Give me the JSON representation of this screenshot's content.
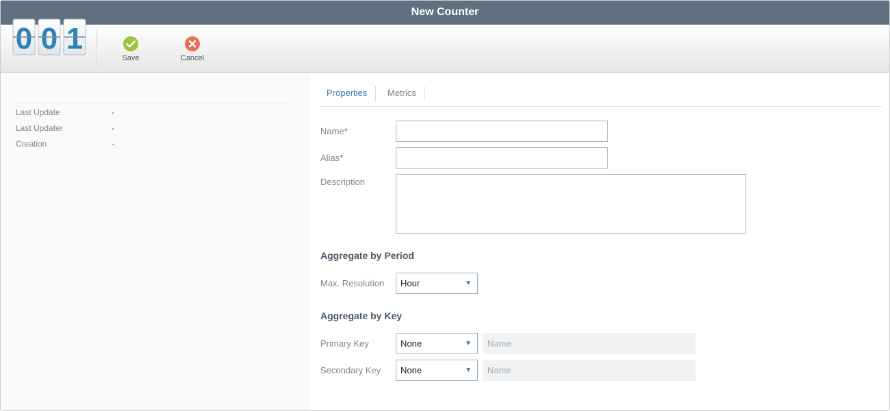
{
  "window": {
    "title": "New Counter"
  },
  "logo": {
    "digits": [
      "0",
      "0",
      "1"
    ]
  },
  "toolbar": {
    "save_label": "Save",
    "cancel_label": "Cancel",
    "save_icon": "check-circle-icon",
    "cancel_icon": "x-circle-icon",
    "save_color": "#9ac43c",
    "cancel_color": "#e8705a"
  },
  "meta": [
    {
      "label": "Last Update",
      "value": "-"
    },
    {
      "label": "Last Updater",
      "value": "-"
    },
    {
      "label": "Creation",
      "value": "-"
    }
  ],
  "tabs": [
    {
      "label": "Properties",
      "active": true
    },
    {
      "label": "Metrics",
      "active": false
    }
  ],
  "form": {
    "name": {
      "label": "Name",
      "required_mark": "*",
      "value": ""
    },
    "alias": {
      "label": "Alias",
      "required_mark": "*",
      "value": ""
    },
    "description": {
      "label": "Description",
      "value": ""
    },
    "period_section": "Aggregate by Period",
    "max_resolution": {
      "label": "Max. Resolution",
      "value": "Hour"
    },
    "key_section": "Aggregate by Key",
    "primary_key": {
      "label": "Primary Key",
      "value": "None",
      "name_placeholder": "Name"
    },
    "secondary_key": {
      "label": "Secondary Key",
      "value": "None",
      "name_placeholder": "Name"
    },
    "dropdown_arrow": "▼"
  },
  "colors": {
    "titlebar": "#607080",
    "active_tab": "#3a78a8",
    "required": "#d64545",
    "logo_digit": "#2d83b5"
  }
}
